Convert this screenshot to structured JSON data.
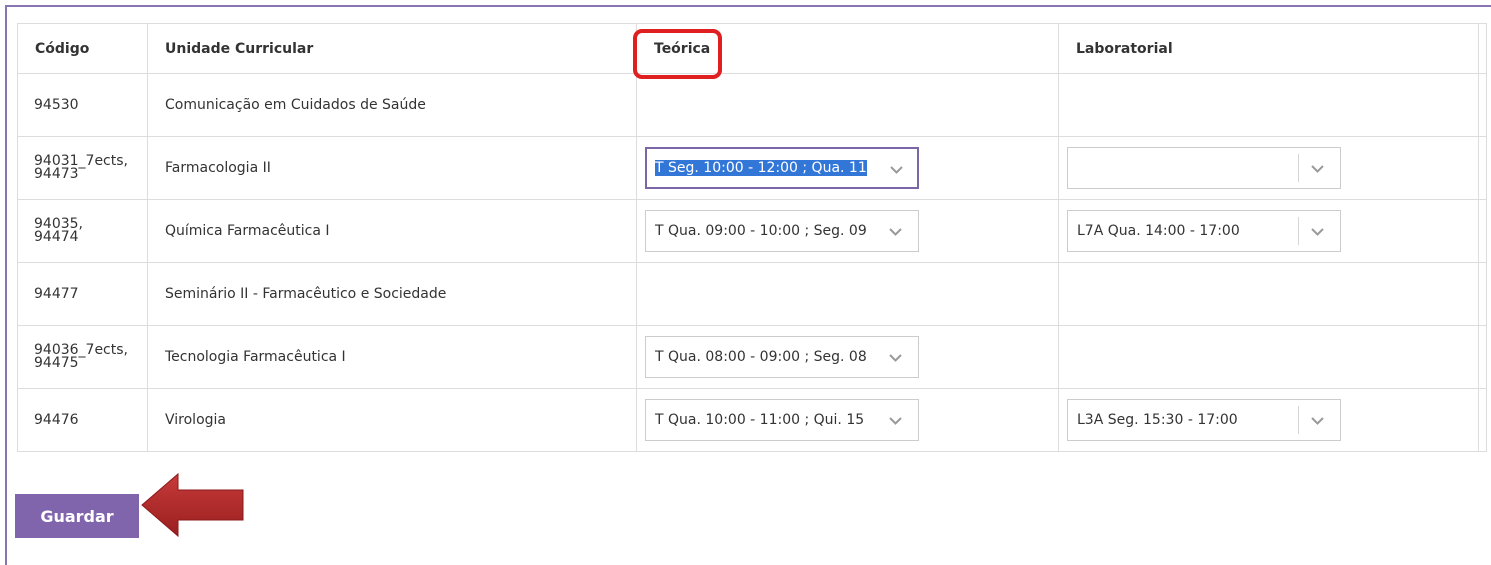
{
  "table": {
    "headers": {
      "code": "Código",
      "unit": "Unidade Curricular",
      "theory": "Teórica",
      "lab": "Laboratorial"
    },
    "rows": [
      {
        "code_line1": "94530",
        "code_line2": "",
        "unit": "Comunicação em Cuidados de Saúde",
        "theory": null,
        "lab": null
      },
      {
        "code_line1": "94031_7ects,",
        "code_line2": "94473",
        "unit": "Farmacologia II",
        "theory": "T Seg. 10:00 - 12:00 ;  Qua. 11",
        "lab": ""
      },
      {
        "code_line1": "94035,",
        "code_line2": "94474",
        "unit": "Química Farmacêutica I",
        "theory": "T Qua. 09:00 - 10:00 ;  Seg. 09",
        "lab": "L7A Qua. 14:00 - 17:00"
      },
      {
        "code_line1": "94477",
        "code_line2": "",
        "unit": "Seminário II - Farmacêutico e Sociedade",
        "theory": null,
        "lab": null
      },
      {
        "code_line1": "94036_7ects,",
        "code_line2": "94475",
        "unit": "Tecnologia Farmacêutica I",
        "theory": "T Qua. 08:00 - 09:00 ;  Seg. 08",
        "lab": null
      },
      {
        "code_line1": "94476",
        "code_line2": "",
        "unit": "Virologia",
        "theory": "T Qua. 10:00 - 11:00 ;  Qui. 15",
        "lab": "L3A Seg. 15:30 - 17:00"
      }
    ]
  },
  "save_button": {
    "label": "Guardar"
  },
  "colors": {
    "accent": "#8065ad",
    "highlight_box": "#e02020",
    "arrow": "#b32a2a",
    "selection": "#3277d8"
  }
}
